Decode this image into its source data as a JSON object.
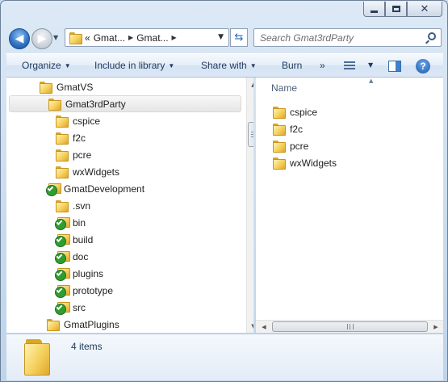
{
  "address": {
    "crumbs": [
      "Gmat...",
      "Gmat..."
    ],
    "overflow": "«"
  },
  "search": {
    "placeholder": "Search Gmat3rdParty"
  },
  "commandbar": {
    "organize": "Organize",
    "include": "Include in library",
    "share": "Share with",
    "burn": "Burn",
    "more": "»"
  },
  "navtree": [
    {
      "label": "GmatVS",
      "icon": "folder-icon"
    },
    {
      "label": "Gmat3rdParty",
      "icon": "folder-icon",
      "selected": true
    },
    {
      "label": "cspice",
      "icon": "folder-icon"
    },
    {
      "label": "f2c",
      "icon": "folder-icon"
    },
    {
      "label": "pcre",
      "icon": "folder-icon"
    },
    {
      "label": "wxWidgets",
      "icon": "folder-icon"
    },
    {
      "label": "GmatDevelopment",
      "icon": "svn-folder-icon"
    },
    {
      "label": ".svn",
      "icon": "folder-icon"
    },
    {
      "label": "bin",
      "icon": "svn-folder-icon"
    },
    {
      "label": "build",
      "icon": "svn-folder-icon"
    },
    {
      "label": "doc",
      "icon": "svn-folder-icon"
    },
    {
      "label": "plugins",
      "icon": "svn-folder-icon"
    },
    {
      "label": "prototype",
      "icon": "svn-folder-icon"
    },
    {
      "label": "src",
      "icon": "svn-folder-icon"
    },
    {
      "label": "GmatPlugins",
      "icon": "folder-icon"
    }
  ],
  "content": {
    "column_header": "Name",
    "items": [
      "cspice",
      "f2c",
      "pcre",
      "wxWidgets"
    ]
  },
  "details": {
    "count_text": "4 items"
  },
  "colors": {
    "accent": "#1e395b",
    "folder": "#f5cf5b",
    "svn": "#2f9e2f"
  }
}
